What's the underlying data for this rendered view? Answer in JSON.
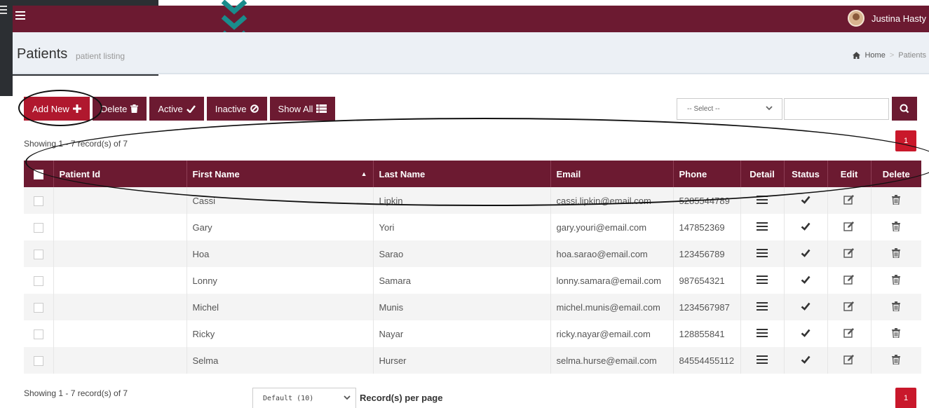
{
  "header": {
    "user_name": "Justina Hasty"
  },
  "page": {
    "title": "Patients",
    "subtitle": "patient listing"
  },
  "breadcrumb": {
    "home": "Home",
    "separator": ">",
    "current": "Patients"
  },
  "toolbar": {
    "add_new": "Add New",
    "delete": "Delete",
    "active": "Active",
    "inactive": "Inactive",
    "show_all": "Show All"
  },
  "filter": {
    "select_value": "-- Select --"
  },
  "summary": {
    "showing": "Showing 1 - 7 record(s) of 7"
  },
  "pagination": {
    "current_page": "1"
  },
  "table": {
    "headers": {
      "patient_id": "Patient Id",
      "first_name": "First Name",
      "last_name": "Last Name",
      "email": "Email",
      "phone": "Phone",
      "detail": "Detail",
      "status": "Status",
      "edit": "Edit",
      "delete": "Delete"
    },
    "rows": [
      {
        "patient_id": "",
        "first_name": "Cassi",
        "last_name": "Lipkin",
        "email": "cassi.lipkin@email.com",
        "phone": "5285544789"
      },
      {
        "patient_id": "",
        "first_name": "Gary",
        "last_name": "Yori",
        "email": "gary.youri@email.com",
        "phone": "147852369"
      },
      {
        "patient_id": "",
        "first_name": "Hoa",
        "last_name": "Sarao",
        "email": "hoa.sarao@email.com",
        "phone": "123456789"
      },
      {
        "patient_id": "",
        "first_name": "Lonny",
        "last_name": "Samara",
        "email": "lonny.samara@email.com",
        "phone": "987654321"
      },
      {
        "patient_id": "",
        "first_name": "Michel",
        "last_name": "Munis",
        "email": "michel.munis@email.com",
        "phone": "1234567987"
      },
      {
        "patient_id": "",
        "first_name": "Ricky",
        "last_name": "Nayar",
        "email": "ricky.nayar@email.com",
        "phone": "128855841"
      },
      {
        "patient_id": "",
        "first_name": "Selma",
        "last_name": "Hurser",
        "email": "selma.hurse@email.com",
        "phone": "84554455112"
      }
    ]
  },
  "footer": {
    "per_page_value": "Default (10)",
    "per_page_label": "Record(s) per page"
  },
  "colors": {
    "brand": "#6c1a31",
    "primary_button": "#b0182e",
    "pager": "#c9182b",
    "chevron_accent": "#1a8c8c"
  },
  "icons": {
    "menu": "hamburger-icon",
    "add": "plus-icon",
    "delete": "trash-icon",
    "active": "check-icon",
    "inactive": "ban-icon",
    "show_all": "list-icon",
    "search": "search-icon",
    "home": "home-icon",
    "detail": "bars-icon",
    "status": "check-icon",
    "edit": "edit-icon"
  }
}
